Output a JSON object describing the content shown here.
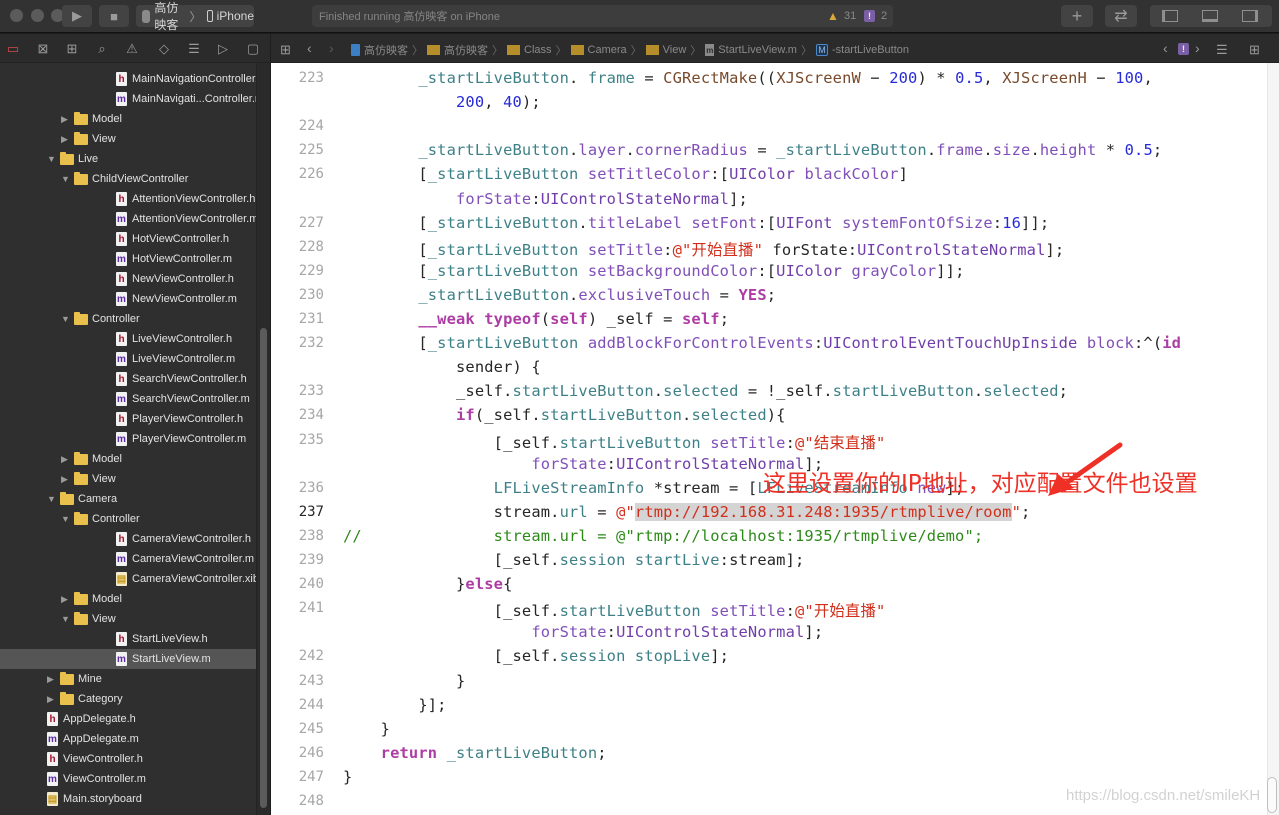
{
  "toolbar": {
    "scheme_name": "高仿映客",
    "device": "iPhone",
    "status_text": "Finished running 高仿映客 on iPhone",
    "warning_count": "31",
    "issue_count": "2",
    "run_icon": "▶",
    "stop_icon": "■",
    "add_icon": "+",
    "swap_icon": "⇄"
  },
  "navigator_icons": [
    "folder-icon",
    "source-control-icon",
    "hierarchy-icon",
    "search-icon",
    "warning-icon",
    "test-icon",
    "debug-icon",
    "breakpoint-icon",
    "report-icon"
  ],
  "jump_bar": {
    "crumbs": [
      "高仿映客",
      "高仿映客",
      "Class",
      "Camera",
      "View",
      "StartLiveView.m",
      "-startLiveButton"
    ],
    "method_badge": "M",
    "issue_badge": "!"
  },
  "sidebar": {
    "items": [
      {
        "label": "MainNavigationController.h",
        "type": "h",
        "depth": 3
      },
      {
        "label": "MainNavigati...Controller.m",
        "type": "m",
        "depth": 3
      },
      {
        "label": "Model",
        "type": "folder",
        "depth": 2,
        "expanded": false
      },
      {
        "label": "View",
        "type": "folder",
        "depth": 2,
        "expanded": false
      },
      {
        "label": "Live",
        "type": "folder",
        "depth": 1,
        "expanded": true
      },
      {
        "label": "ChildViewController",
        "type": "folder",
        "depth": 2,
        "expanded": true
      },
      {
        "label": "AttentionViewController.h",
        "type": "h",
        "depth": 3
      },
      {
        "label": "AttentionViewController.m",
        "type": "m",
        "depth": 3
      },
      {
        "label": "HotViewController.h",
        "type": "h",
        "depth": 3
      },
      {
        "label": "HotViewController.m",
        "type": "m",
        "depth": 3
      },
      {
        "label": "NewViewController.h",
        "type": "h",
        "depth": 3
      },
      {
        "label": "NewViewController.m",
        "type": "m",
        "depth": 3
      },
      {
        "label": "Controller",
        "type": "folder",
        "depth": 2,
        "expanded": true
      },
      {
        "label": "LiveViewController.h",
        "type": "h",
        "depth": 3
      },
      {
        "label": "LiveViewController.m",
        "type": "m",
        "depth": 3
      },
      {
        "label": "SearchViewController.h",
        "type": "h",
        "depth": 3
      },
      {
        "label": "SearchViewController.m",
        "type": "m",
        "depth": 3
      },
      {
        "label": "PlayerViewController.h",
        "type": "h",
        "depth": 3
      },
      {
        "label": "PlayerViewController.m",
        "type": "m",
        "depth": 3
      },
      {
        "label": "Model",
        "type": "folder",
        "depth": 2,
        "expanded": false
      },
      {
        "label": "View",
        "type": "folder",
        "depth": 2,
        "expanded": false
      },
      {
        "label": "Camera",
        "type": "folder",
        "depth": 1,
        "expanded": true
      },
      {
        "label": "Controller",
        "type": "folder",
        "depth": 2,
        "expanded": true
      },
      {
        "label": "CameraViewController.h",
        "type": "h",
        "depth": 3
      },
      {
        "label": "CameraViewController.m",
        "type": "m",
        "depth": 3
      },
      {
        "label": "CameraViewController.xib",
        "type": "xib",
        "depth": 3
      },
      {
        "label": "Model",
        "type": "folder",
        "depth": 2,
        "expanded": false
      },
      {
        "label": "View",
        "type": "folder",
        "depth": 2,
        "expanded": true
      },
      {
        "label": "StartLiveView.h",
        "type": "h",
        "depth": 3
      },
      {
        "label": "StartLiveView.m",
        "type": "m",
        "depth": 3,
        "selected": true
      },
      {
        "label": "Mine",
        "type": "folder",
        "depth": 1,
        "expanded": false
      },
      {
        "label": "Category",
        "type": "folder",
        "depth": 1,
        "expanded": false
      },
      {
        "label": "AppDelegate.h",
        "type": "h",
        "depth": 0
      },
      {
        "label": "AppDelegate.m",
        "type": "m",
        "depth": 0
      },
      {
        "label": "ViewController.h",
        "type": "h",
        "depth": 0
      },
      {
        "label": "ViewController.m",
        "type": "m",
        "depth": 0
      },
      {
        "label": "Main.storyboard",
        "type": "sb",
        "depth": 0
      }
    ]
  },
  "editor": {
    "current_line": "237",
    "lines": [
      {
        "n": "223",
        "segs": [
          [
            "",
            "        "
          ],
          [
            "prop",
            "_startLiveButton"
          ],
          [
            "",
            ". "
          ],
          [
            "prop",
            "frame"
          ],
          [
            "",
            " = "
          ],
          [
            "mac",
            "CGRectMake"
          ],
          [
            "",
            "(("
          ],
          [
            "mac",
            "XJScreenW"
          ],
          [
            "",
            " − "
          ],
          [
            "num",
            "200"
          ],
          [
            "",
            ") * "
          ],
          [
            "num",
            "0.5"
          ],
          [
            "",
            ", "
          ],
          [
            "mac",
            "XJScreenH"
          ],
          [
            "",
            " − "
          ],
          [
            "num",
            "100"
          ],
          [
            "",
            ","
          ]
        ]
      },
      {
        "n": "",
        "segs": [
          [
            "",
            "            "
          ],
          [
            "num",
            "200"
          ],
          [
            "",
            ", "
          ],
          [
            "num",
            "40"
          ],
          [
            "",
            ");"
          ]
        ]
      },
      {
        "n": "224",
        "segs": []
      },
      {
        "n": "225",
        "segs": [
          [
            "",
            "        "
          ],
          [
            "prop",
            "_startLiveButton"
          ],
          [
            "",
            "."
          ],
          [
            "meth",
            "layer"
          ],
          [
            "",
            "."
          ],
          [
            "meth",
            "cornerRadius"
          ],
          [
            "",
            " = "
          ],
          [
            "prop",
            "_startLiveButton"
          ],
          [
            "",
            "."
          ],
          [
            "meth",
            "frame"
          ],
          [
            "",
            "."
          ],
          [
            "meth",
            "size"
          ],
          [
            "",
            "."
          ],
          [
            "meth",
            "height"
          ],
          [
            "",
            " * "
          ],
          [
            "num",
            "0.5"
          ],
          [
            "",
            ";"
          ]
        ]
      },
      {
        "n": "226",
        "segs": [
          [
            "",
            "        ["
          ],
          [
            "prop",
            "_startLiveButton"
          ],
          [
            "",
            " "
          ],
          [
            "meth",
            "setTitleColor"
          ],
          [
            "",
            ":["
          ],
          [
            "cls",
            "UIColor"
          ],
          [
            "",
            " "
          ],
          [
            "meth",
            "blackColor"
          ],
          [
            "",
            "]"
          ]
        ]
      },
      {
        "n": "",
        "segs": [
          [
            "",
            "            "
          ],
          [
            "meth",
            "forState"
          ],
          [
            "",
            ":"
          ],
          [
            "cls",
            "UIControlStateNormal"
          ],
          [
            "",
            "];"
          ]
        ]
      },
      {
        "n": "227",
        "segs": [
          [
            "",
            "        ["
          ],
          [
            "prop",
            "_startLiveButton"
          ],
          [
            "",
            "."
          ],
          [
            "meth",
            "titleLabel"
          ],
          [
            "",
            " "
          ],
          [
            "meth",
            "setFont"
          ],
          [
            "",
            ":["
          ],
          [
            "cls",
            "UIFont"
          ],
          [
            "",
            " "
          ],
          [
            "meth",
            "systemFontOfSize"
          ],
          [
            "",
            ":"
          ],
          [
            "num",
            "16"
          ],
          [
            "",
            "]];"
          ]
        ]
      },
      {
        "n": "228",
        "segs": [
          [
            "",
            "        ["
          ],
          [
            "prop",
            "_startLiveButton"
          ],
          [
            "",
            " "
          ],
          [
            "meth",
            "setTitle"
          ],
          [
            "",
            ":"
          ],
          [
            "str",
            "@\"开始直播\""
          ],
          [
            "",
            " forState:"
          ],
          [
            "cls",
            "UIControlStateNormal"
          ],
          [
            "",
            "];"
          ]
        ]
      },
      {
        "n": "229",
        "segs": [
          [
            "",
            "        ["
          ],
          [
            "prop",
            "_startLiveButton"
          ],
          [
            "",
            " "
          ],
          [
            "meth",
            "setBackgroundColor"
          ],
          [
            "",
            ":["
          ],
          [
            "cls",
            "UIColor"
          ],
          [
            "",
            " "
          ],
          [
            "meth",
            "grayColor"
          ],
          [
            "",
            "]];"
          ]
        ]
      },
      {
        "n": "230",
        "segs": [
          [
            "",
            "        "
          ],
          [
            "prop",
            "_startLiveButton"
          ],
          [
            "",
            "."
          ],
          [
            "meth",
            "exclusiveTouch"
          ],
          [
            "",
            " = "
          ],
          [
            "kw",
            "YES"
          ],
          [
            "",
            ";"
          ]
        ]
      },
      {
        "n": "231",
        "segs": [
          [
            "",
            "        "
          ],
          [
            "kw",
            "__weak"
          ],
          [
            "",
            " "
          ],
          [
            "kw",
            "typeof"
          ],
          [
            "",
            "("
          ],
          [
            "kw",
            "self"
          ],
          [
            "",
            ") _self = "
          ],
          [
            "kw",
            "self"
          ],
          [
            "",
            ";"
          ]
        ]
      },
      {
        "n": "232",
        "segs": [
          [
            "",
            "        ["
          ],
          [
            "prop",
            "_startLiveButton"
          ],
          [
            "",
            " "
          ],
          [
            "meth",
            "addBlockForControlEvents"
          ],
          [
            "",
            ":"
          ],
          [
            "cls",
            "UIControlEventTouchUpInside"
          ],
          [
            "",
            " "
          ],
          [
            "meth",
            "block"
          ],
          [
            "",
            ":^("
          ],
          [
            "kw",
            "id"
          ]
        ]
      },
      {
        "n": "",
        "segs": [
          [
            "",
            "            sender) {"
          ]
        ]
      },
      {
        "n": "233",
        "segs": [
          [
            "",
            "            _self."
          ],
          [
            "prop",
            "startLiveButton"
          ],
          [
            "",
            "."
          ],
          [
            "prop",
            "selected"
          ],
          [
            "",
            " = !_self."
          ],
          [
            "prop",
            "startLiveButton"
          ],
          [
            "",
            "."
          ],
          [
            "prop",
            "selected"
          ],
          [
            "",
            ";"
          ]
        ]
      },
      {
        "n": "234",
        "segs": [
          [
            "",
            "            "
          ],
          [
            "kw",
            "if"
          ],
          [
            "",
            "(_self."
          ],
          [
            "prop",
            "startLiveButton"
          ],
          [
            "",
            "."
          ],
          [
            "prop",
            "selected"
          ],
          [
            "",
            "){"
          ]
        ]
      },
      {
        "n": "235",
        "segs": [
          [
            "",
            "                [_self."
          ],
          [
            "prop",
            "startLiveButton"
          ],
          [
            "",
            " "
          ],
          [
            "meth",
            "setTitle"
          ],
          [
            "",
            ":"
          ],
          [
            "str",
            "@\"结束直播\""
          ]
        ]
      },
      {
        "n": "",
        "segs": [
          [
            "",
            "                    "
          ],
          [
            "meth",
            "forState"
          ],
          [
            "",
            ":"
          ],
          [
            "cls",
            "UIControlStateNormal"
          ],
          [
            "",
            "];"
          ]
        ]
      },
      {
        "n": "236",
        "segs": [
          [
            "",
            "                "
          ],
          [
            "prop",
            "LFLiveStreamInfo"
          ],
          [
            "",
            " *stream = ["
          ],
          [
            "prop",
            "LFLiveStreamInfo"
          ],
          [
            "",
            " "
          ],
          [
            "meth",
            "new"
          ],
          [
            "",
            "];"
          ]
        ]
      },
      {
        "n": "237",
        "segs": [
          [
            "",
            "                stream."
          ],
          [
            "prop",
            "url"
          ],
          [
            "",
            " = "
          ],
          [
            "str",
            "@\""
          ],
          [
            "strsel",
            "rtmp://192.168.31.248:1935/rtmplive/room"
          ],
          [
            "str",
            "\""
          ],
          [
            "",
            ";"
          ]
        ]
      },
      {
        "n": "238",
        "segs": [
          [
            "cmt",
            "//              stream.url = @\"rtmp://localhost:1935/rtmplive/demo\";"
          ]
        ]
      },
      {
        "n": "239",
        "segs": [
          [
            "",
            "                [_self."
          ],
          [
            "prop",
            "session"
          ],
          [
            "",
            " "
          ],
          [
            "prop",
            "startLive"
          ],
          [
            "",
            ":stream];"
          ]
        ]
      },
      {
        "n": "240",
        "segs": [
          [
            "",
            "            }"
          ],
          [
            "kw",
            "else"
          ],
          [
            "",
            "{"
          ]
        ]
      },
      {
        "n": "241",
        "segs": [
          [
            "",
            "                [_self."
          ],
          [
            "prop",
            "startLiveButton"
          ],
          [
            "",
            " "
          ],
          [
            "meth",
            "setTitle"
          ],
          [
            "",
            ":"
          ],
          [
            "str",
            "@\"开始直播\""
          ]
        ]
      },
      {
        "n": "",
        "segs": [
          [
            "",
            "                    "
          ],
          [
            "meth",
            "forState"
          ],
          [
            "",
            ":"
          ],
          [
            "cls",
            "UIControlStateNormal"
          ],
          [
            "",
            "];"
          ]
        ]
      },
      {
        "n": "242",
        "segs": [
          [
            "",
            "                [_self."
          ],
          [
            "prop",
            "session"
          ],
          [
            "",
            " "
          ],
          [
            "prop",
            "stopLive"
          ],
          [
            "",
            "];"
          ]
        ]
      },
      {
        "n": "243",
        "segs": [
          [
            "",
            "            }"
          ]
        ]
      },
      {
        "n": "244",
        "segs": [
          [
            "",
            "        }];"
          ]
        ]
      },
      {
        "n": "245",
        "segs": [
          [
            "",
            "    }"
          ]
        ]
      },
      {
        "n": "246",
        "segs": [
          [
            "",
            "    "
          ],
          [
            "kw",
            "return"
          ],
          [
            "",
            " "
          ],
          [
            "prop",
            "_startLiveButton"
          ],
          [
            "",
            ";"
          ]
        ]
      },
      {
        "n": "247",
        "segs": [
          [
            "",
            "}"
          ]
        ]
      },
      {
        "n": "248",
        "segs": []
      }
    ]
  },
  "annotation": {
    "text": "这里设置你的IP地址，对应配置文件也设置",
    "color": "#ee3026"
  },
  "watermark": "https://blog.csdn.net/smileKH"
}
